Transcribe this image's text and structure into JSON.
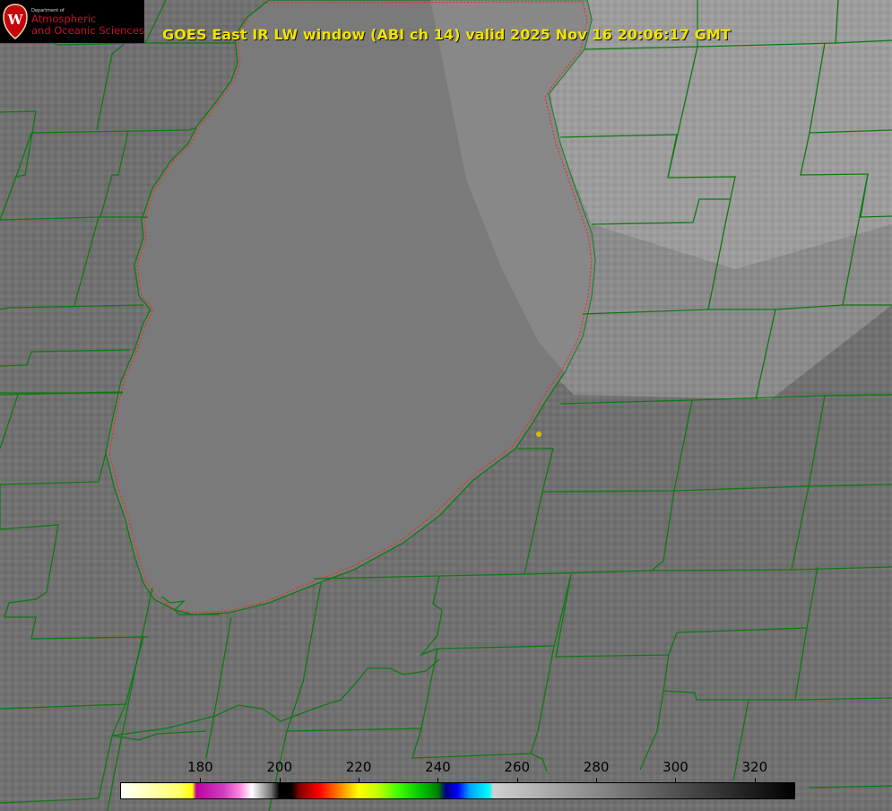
{
  "title": "GOES East IR LW window (ABI ch 14) valid 2025 Nov 16 20:06:17 GMT",
  "logo": {
    "department": "Department of",
    "line1": "Atmospheric",
    "line2": "and Oceanic Sciences",
    "seal_letter": "W"
  },
  "colorbar": {
    "min": 160,
    "max": 330,
    "ticks": [
      "180",
      "200",
      "220",
      "240",
      "260",
      "280",
      "300",
      "320"
    ],
    "stops": [
      {
        "t": 160,
        "c": "#ffffff"
      },
      {
        "t": 175,
        "c": "#ffff66"
      },
      {
        "t": 178,
        "c": "#ffff00"
      },
      {
        "t": 179,
        "c": "#c000a0"
      },
      {
        "t": 186,
        "c": "#d040c0"
      },
      {
        "t": 190,
        "c": "#ff88e0"
      },
      {
        "t": 193,
        "c": "#ffffff"
      },
      {
        "t": 198,
        "c": "#707070"
      },
      {
        "t": 200,
        "c": "#000000"
      },
      {
        "t": 203,
        "c": "#000000"
      },
      {
        "t": 205,
        "c": "#800000"
      },
      {
        "t": 210,
        "c": "#ff0000"
      },
      {
        "t": 215,
        "c": "#ff8000"
      },
      {
        "t": 220,
        "c": "#ffff00"
      },
      {
        "t": 225,
        "c": "#c0ff00"
      },
      {
        "t": 230,
        "c": "#40ff00"
      },
      {
        "t": 236,
        "c": "#00c000"
      },
      {
        "t": 240,
        "c": "#008000"
      },
      {
        "t": 242,
        "c": "#000080"
      },
      {
        "t": 245,
        "c": "#0000ff"
      },
      {
        "t": 248,
        "c": "#00a0ff"
      },
      {
        "t": 253,
        "c": "#00ffff"
      },
      {
        "t": 254,
        "c": "#d0d0d0"
      },
      {
        "t": 330,
        "c": "#000000"
      }
    ]
  },
  "colors": {
    "boundary": "#0e7a10",
    "shoreline_dots": "#ff2020",
    "lake": "#777777",
    "title": "#f2e200",
    "marker": "#d7c000"
  },
  "marker": {
    "label": "station-dot"
  }
}
